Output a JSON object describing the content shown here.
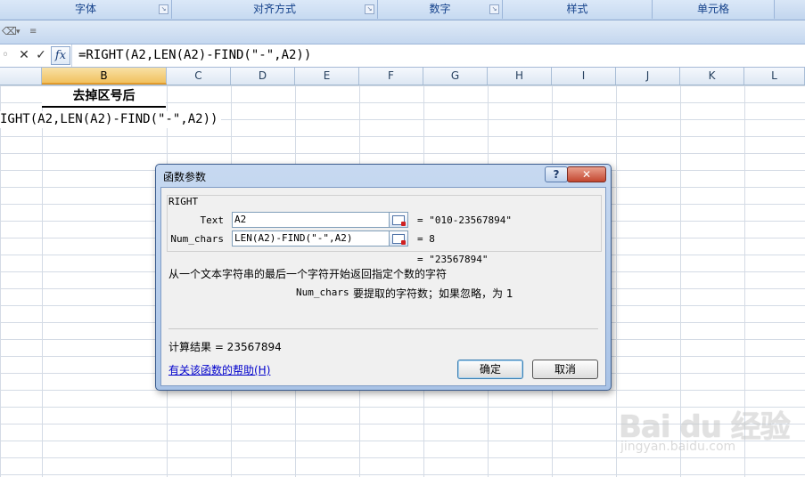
{
  "ribbon": {
    "groups": [
      "字体",
      "对齐方式",
      "数字",
      "样式",
      "单元格"
    ]
  },
  "formula_bar": {
    "cancel_glyph": "✕",
    "enter_glyph": "✓",
    "fx_label": "fx",
    "formula": "=RIGHT(A2,LEN(A2)-FIND(\"-\",A2))"
  },
  "columns": [
    "B",
    "C",
    "D",
    "E",
    "F",
    "G",
    "H",
    "I",
    "J",
    "K",
    "L"
  ],
  "sheet": {
    "b1_header": "去掉区号后",
    "row2_formula": "IGHT(A2,LEN(A2)-FIND(\"-\",A2))"
  },
  "dialog": {
    "title": "函数参数",
    "help_glyph": "?",
    "close_glyph": "✕",
    "function_name": "RIGHT",
    "args": [
      {
        "label": "Text",
        "value": "A2",
        "result": "= \"010-23567894\""
      },
      {
        "label": "Num_chars",
        "value": "LEN(A2)-FIND(\"-\",A2)",
        "result": "= 8"
      }
    ],
    "formula_result": "= \"23567894\"",
    "description": "从一个文本字符串的最后一个字符开始返回指定个数的字符",
    "arg_desc_name": "Num_chars",
    "arg_desc_text": "要提取的字符数；如果忽略，为 1",
    "calc_result": "计算结果 = 23567894",
    "help_link": "有关该函数的帮助(H)",
    "ok_label": "确定",
    "cancel_label": "取消"
  },
  "watermark": {
    "main": "Bai du 经验",
    "sub": "jingyan.baidu.com"
  }
}
